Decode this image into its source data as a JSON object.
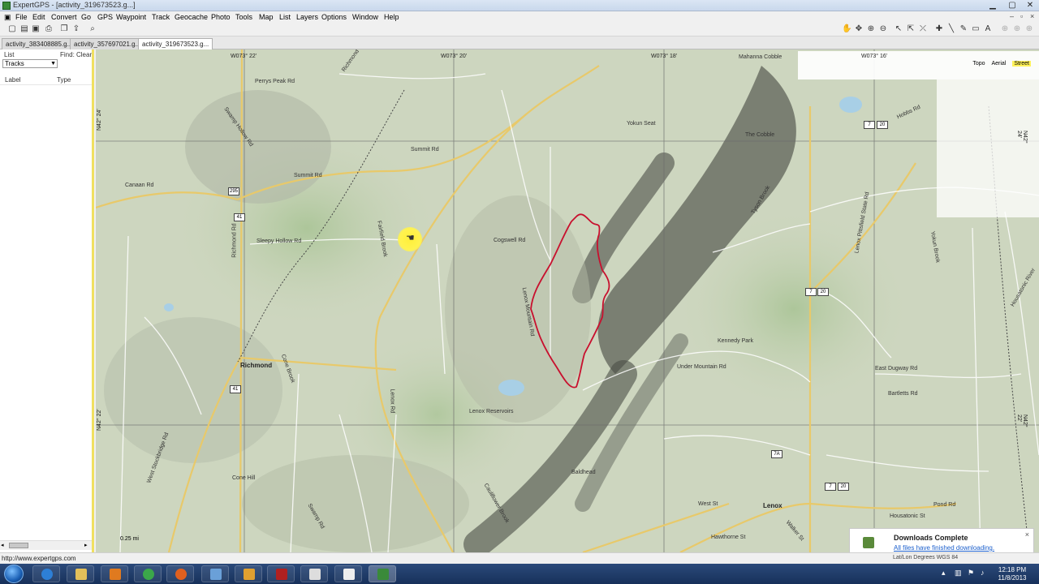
{
  "window": {
    "title": "ExpertGPS - [activity_319673523.g...]"
  },
  "menu": {
    "items": [
      "File",
      "Edit",
      "Convert",
      "Go",
      "GPS",
      "Waypoint",
      "Track",
      "Geocache",
      "Photo",
      "Tools",
      "Map",
      "List",
      "Layers",
      "Options",
      "Window",
      "Help"
    ]
  },
  "tabs": [
    "activity_383408885.g...",
    "activity_357697021.g...",
    "activity_319673523.g..."
  ],
  "sidebar": {
    "list_label": "List",
    "find_label": "Find:",
    "clear_label": "Clear",
    "select_value": "Tracks",
    "col_label": "Label",
    "col_type": "Type"
  },
  "map": {
    "coords_top": [
      "W073° 22'",
      "W073° 20'",
      "W073° 18'",
      "W073° 16'"
    ],
    "coords_left": [
      "N42° 24'",
      "N42° 22'"
    ],
    "coords_right": [
      "N42° 24'",
      "N42° 22'"
    ],
    "map_types": [
      "Topo",
      "Aerial",
      "Street"
    ],
    "active_type": "Street",
    "scale": "0.25 mi",
    "labels": {
      "perrys_peak": "Perrys Peak Rd",
      "richmond_rd_n": "Richmond Rd",
      "swamp_hollow": "Swamp Hollow Rd",
      "canaan": "Canaan Rd",
      "summit1": "Summit Rd",
      "summit2": "Summit Rd",
      "sleepy": "Sleepy Hollow Rd",
      "richmond_rd_v": "Richmond Rd",
      "fairfield": "Fairfield Brook",
      "cogswell": "Cogswell Rd",
      "yokun_seat": "Yokun Seat",
      "the_cobble": "The Cobble",
      "hobbs": "Hobbs Rd",
      "mahanna": "Mahanna Cobble",
      "tyson": "Tyson Brook",
      "lenox_pittsfield": "Lenox Pittsfield State Rd",
      "yokun_brook": "Yokun Brook",
      "cauliflower": "Cauliflower Brook",
      "lenox_mountain": "Lenox Mountain Rd",
      "kennedy_park": "Kennedy Park",
      "richmond": "Richmond",
      "cone_brook": "Cone Brook",
      "lenox_rd": "Lenox Rd",
      "lenox_res": "Lenox Reservoirs",
      "undermtn": "Under Mountain Rd",
      "west_stockbridge": "West Stockbridge Rd",
      "swamp_rd": "Swamp Rd",
      "cone_hill": "Cone Hill",
      "baldhead": "Baldhead",
      "west_st": "West St",
      "hawthorne": "Hawthorne St",
      "housatonic": "Housatonic St",
      "lenox": "Lenox",
      "walker": "Walker St",
      "bartletts": "Bartletts Rd",
      "east_dugway": "East Dugway Rd",
      "pond_rd": "Pond Rd",
      "housatonic_river": "Housatonic River"
    },
    "shields": [
      "295",
      "41",
      "41",
      "7",
      "20",
      "7",
      "20",
      "7A",
      "7",
      "20"
    ]
  },
  "notification": {
    "title": "Downloads Complete",
    "link": "All files have finished downloading."
  },
  "status": {
    "url": "http://www.expertgps.com",
    "datum": "Lat/Lon Degrees WGS 84"
  },
  "taskbar": {
    "time": "12:18 PM",
    "date": "11/8/2013"
  },
  "colors": {
    "track": "#c8102e",
    "sidebar_border": "#f0e060",
    "highlight": "#fff25a"
  }
}
